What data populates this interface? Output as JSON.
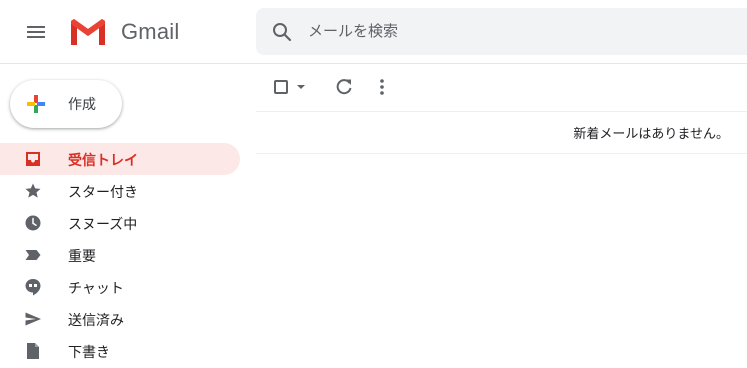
{
  "header": {
    "app_name": "Gmail",
    "search_placeholder": "メールを検索"
  },
  "compose": {
    "label": "作成"
  },
  "sidebar": {
    "items": [
      {
        "label": "受信トレイ",
        "icon": "inbox-icon",
        "active": true
      },
      {
        "label": "スター付き",
        "icon": "star-icon",
        "active": false
      },
      {
        "label": "スヌーズ中",
        "icon": "clock-icon",
        "active": false
      },
      {
        "label": "重要",
        "icon": "important-icon",
        "active": false
      },
      {
        "label": "チャット",
        "icon": "chat-icon",
        "active": false
      },
      {
        "label": "送信済み",
        "icon": "send-icon",
        "active": false
      },
      {
        "label": "下書き",
        "icon": "draft-icon",
        "active": false
      }
    ]
  },
  "main": {
    "empty_message": "新着メールはありません。"
  },
  "colors": {
    "accent_red": "#d93025",
    "active_bg": "#fce8e6",
    "icon_gray": "#5f6368",
    "search_bg": "#f1f3f4"
  }
}
